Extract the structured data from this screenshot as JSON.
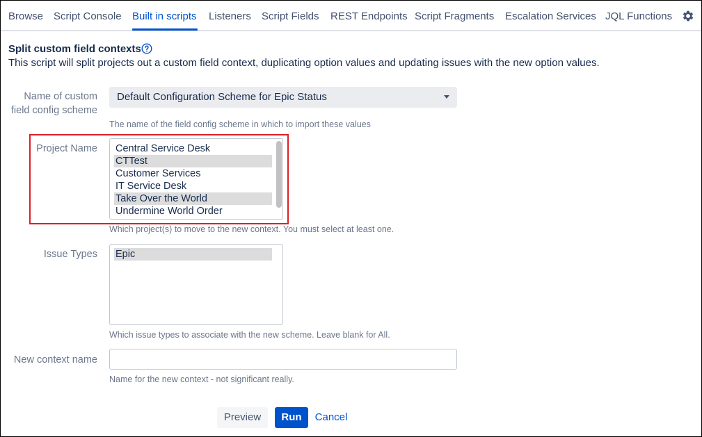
{
  "tabs": [
    {
      "label": "Browse",
      "active": false
    },
    {
      "label": "Script Console",
      "active": false
    },
    {
      "label": "Built in scripts",
      "active": true
    },
    {
      "label": "Listeners",
      "active": false
    },
    {
      "label": "Script Fields",
      "active": false
    },
    {
      "label": "REST Endpoints",
      "active": false
    },
    {
      "label": "Script Fragments",
      "active": false
    },
    {
      "label": "Escalation Services",
      "active": false
    },
    {
      "label": "JQL Functions",
      "active": false
    }
  ],
  "header": {
    "title": "Split custom field contexts",
    "description": "This script will split projects out a custom field context, duplicating option values and updating issues with the new option values."
  },
  "form": {
    "scheme": {
      "label_line1": "Name of custom",
      "label_line2": "field config scheme",
      "value": "Default Configuration Scheme for Epic Status",
      "hint": "The name of the field config scheme in which to import these values"
    },
    "project": {
      "label": "Project Name",
      "items": [
        {
          "label": "Central Service Desk",
          "selected": false
        },
        {
          "label": "CTTest",
          "selected": true
        },
        {
          "label": "Customer Services",
          "selected": false
        },
        {
          "label": "IT Service Desk",
          "selected": false
        },
        {
          "label": "Take Over the World",
          "selected": true
        },
        {
          "label": "Undermine World Order",
          "selected": false
        }
      ],
      "hint": "Which project(s) to move to the new context. You must select at least one."
    },
    "issue_types": {
      "label": "Issue Types",
      "items": [
        {
          "label": "Epic",
          "selected": true
        }
      ],
      "hint": "Which issue types to associate with the new scheme. Leave blank for All."
    },
    "context_name": {
      "label": "New context name",
      "value": "",
      "hint": "Name for the new context - not significant really."
    }
  },
  "actions": {
    "preview_label": "Preview",
    "run_label": "Run",
    "cancel_label": "Cancel"
  },
  "colors": {
    "accent": "#0052cc",
    "highlight": "#de1f26",
    "selected_row": "#dcdcdc"
  },
  "icons": {
    "settings": "gear-icon",
    "help": "help-icon",
    "dropdown": "chevron-down-icon"
  }
}
